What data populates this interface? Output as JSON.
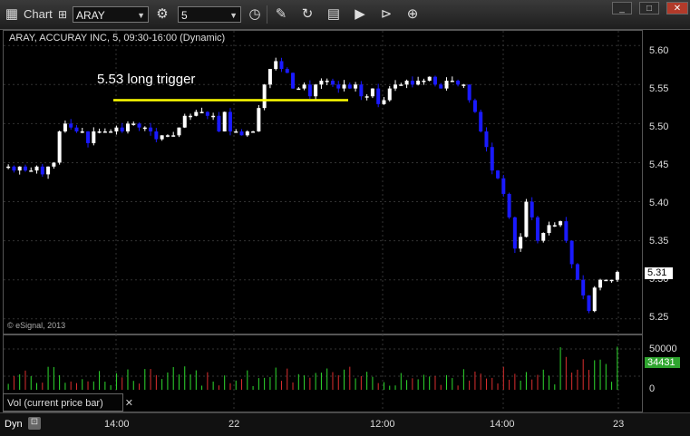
{
  "toolbar": {
    "app_label": "Chart",
    "symbol": "ARAY",
    "interval": "5",
    "icons": [
      "chart-icon",
      "settings-icon",
      "clock-icon",
      "pencil-icon",
      "refresh-icon",
      "calendar-icon",
      "play-icon",
      "link-icon"
    ]
  },
  "chart": {
    "header": "ARAY, ACCURAY INC, 5, 09:30-16:00 (Dynamic)",
    "annotation": "5.53 long trigger",
    "copyright": "© eSignal, 2013",
    "last_price": "5.31",
    "y_ticks": [
      "5.60",
      "5.55",
      "5.50",
      "5.45",
      "5.40",
      "5.35",
      "5.30",
      "5.25"
    ],
    "volume_ticks": [
      "50000",
      "0"
    ],
    "last_volume": "34431",
    "volume_legend": "Vol (current price bar)",
    "x_labels": [
      "14:00",
      "22",
      "12:00",
      "14:00",
      "23"
    ],
    "footer_label": "Dyn",
    "colors": {
      "up": "#ffffff",
      "down": "#1a1aff",
      "trigger_line": "#ffff00",
      "volume_up": "#2fdc2f",
      "volume_down": "#dc2f2f"
    }
  },
  "chart_data": {
    "type": "candlestick",
    "title": "ARAY, ACCURAY INC, 5, 09:30-16:00 (Dynamic)",
    "ylim": [
      5.23,
      5.62
    ],
    "trigger_level": 5.53,
    "closes": [
      5.445,
      5.44,
      5.445,
      5.44,
      5.44,
      5.445,
      5.435,
      5.445,
      5.45,
      5.49,
      5.5,
      5.495,
      5.49,
      5.49,
      5.475,
      5.49,
      5.49,
      5.49,
      5.49,
      5.495,
      5.49,
      5.5,
      5.5,
      5.495,
      5.495,
      5.49,
      5.48,
      5.485,
      5.485,
      5.485,
      5.495,
      5.51,
      5.51,
      5.515,
      5.515,
      5.51,
      5.51,
      5.49,
      5.515,
      5.49,
      5.49,
      5.485,
      5.49,
      5.49,
      5.52,
      5.55,
      5.57,
      5.58,
      5.57,
      5.565,
      5.545,
      5.545,
      5.55,
      5.535,
      5.55,
      5.555,
      5.555,
      5.55,
      5.545,
      5.55,
      5.545,
      5.55,
      5.535,
      5.535,
      5.545,
      5.525,
      5.53,
      5.545,
      5.55,
      5.55,
      5.555,
      5.55,
      5.555,
      5.555,
      5.56,
      5.55,
      5.545,
      5.555,
      5.555,
      5.55,
      5.55,
      5.53,
      5.515,
      5.49,
      5.47,
      5.44,
      5.43,
      5.41,
      5.38,
      5.34,
      5.355,
      5.4,
      5.38,
      5.35,
      5.36,
      5.37,
      5.37,
      5.375,
      5.35,
      5.32,
      5.3,
      5.28,
      5.26,
      5.29,
      5.3,
      5.3,
      5.3,
      5.31
    ],
    "volume_max": 70000
  }
}
